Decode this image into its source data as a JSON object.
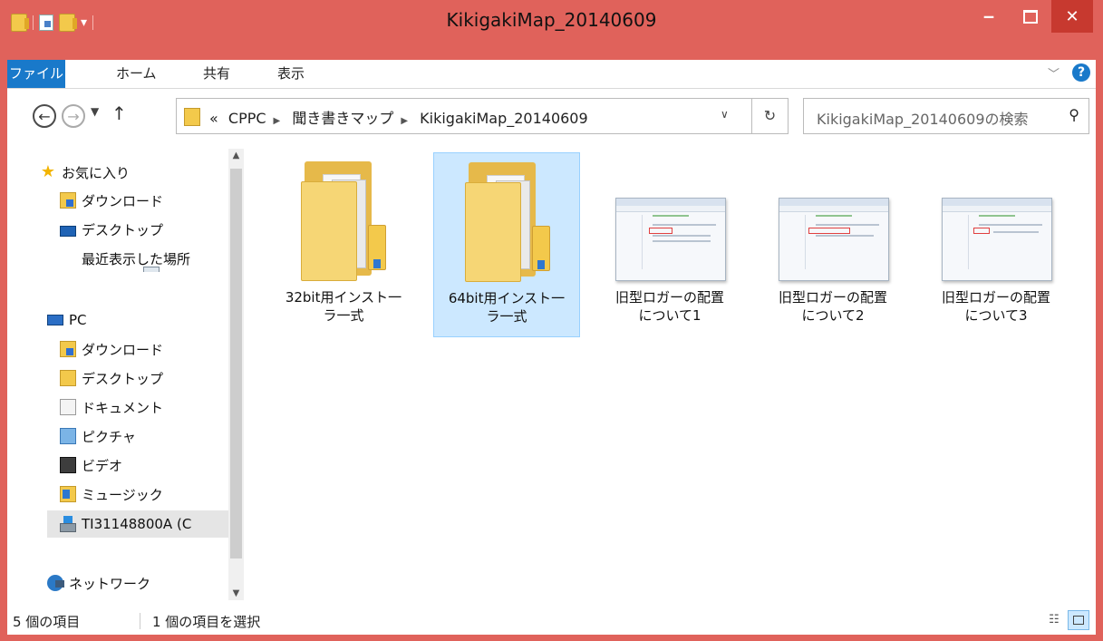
{
  "window": {
    "title": "KikigakiMap_20140609",
    "accent": "#e0625b",
    "close_color": "#c7392f"
  },
  "ribbon": {
    "file": "ファイル",
    "home": "ホーム",
    "share": "共有",
    "view": "表示"
  },
  "address": {
    "crumbs": [
      "CPPC",
      "聞き書きマップ",
      "KikigakiMap_20140609"
    ],
    "prefix": "«"
  },
  "search": {
    "placeholder": "KikigakiMap_20140609の検索"
  },
  "nav": {
    "favorites": "お気に入り",
    "fav_items": [
      "ダウンロード",
      "デスクトップ",
      "最近表示した場所"
    ],
    "pc": "PC",
    "pc_items": [
      "ダウンロード",
      "デスクトップ",
      "ドキュメント",
      "ピクチャ",
      "ビデオ",
      "ミュージック",
      "TI31148800A (C"
    ],
    "network": "ネットワーク"
  },
  "items": [
    {
      "name": "32bit用インストーラー式",
      "line1": "32bit用インスト一",
      "line2": "ラ一式",
      "type": "folder",
      "selected": false
    },
    {
      "name": "64bit用インストーラー式",
      "line1": "64bit用インスト一",
      "line2": "ラ一式",
      "type": "folder",
      "selected": true
    },
    {
      "name": "旧型ロガーの配置について1",
      "line1": "旧型ロガーの配置",
      "line2": "について1",
      "type": "image",
      "selected": false
    },
    {
      "name": "旧型ロガーの配置について2",
      "line1": "旧型ロガーの配置",
      "line2": "について2",
      "type": "image",
      "selected": false
    },
    {
      "name": "旧型ロガーの配置について3",
      "line1": "旧型ロガーの配置",
      "line2": "について3",
      "type": "image",
      "selected": false
    }
  ],
  "status": {
    "count": "5 個の項目",
    "selected": "1 個の項目を選択"
  },
  "icons": {
    "back": "back-arrow-icon",
    "forward": "forward-arrow-icon",
    "up": "up-arrow-icon",
    "refresh": "refresh-icon",
    "search": "search-icon",
    "help": "help-icon"
  }
}
